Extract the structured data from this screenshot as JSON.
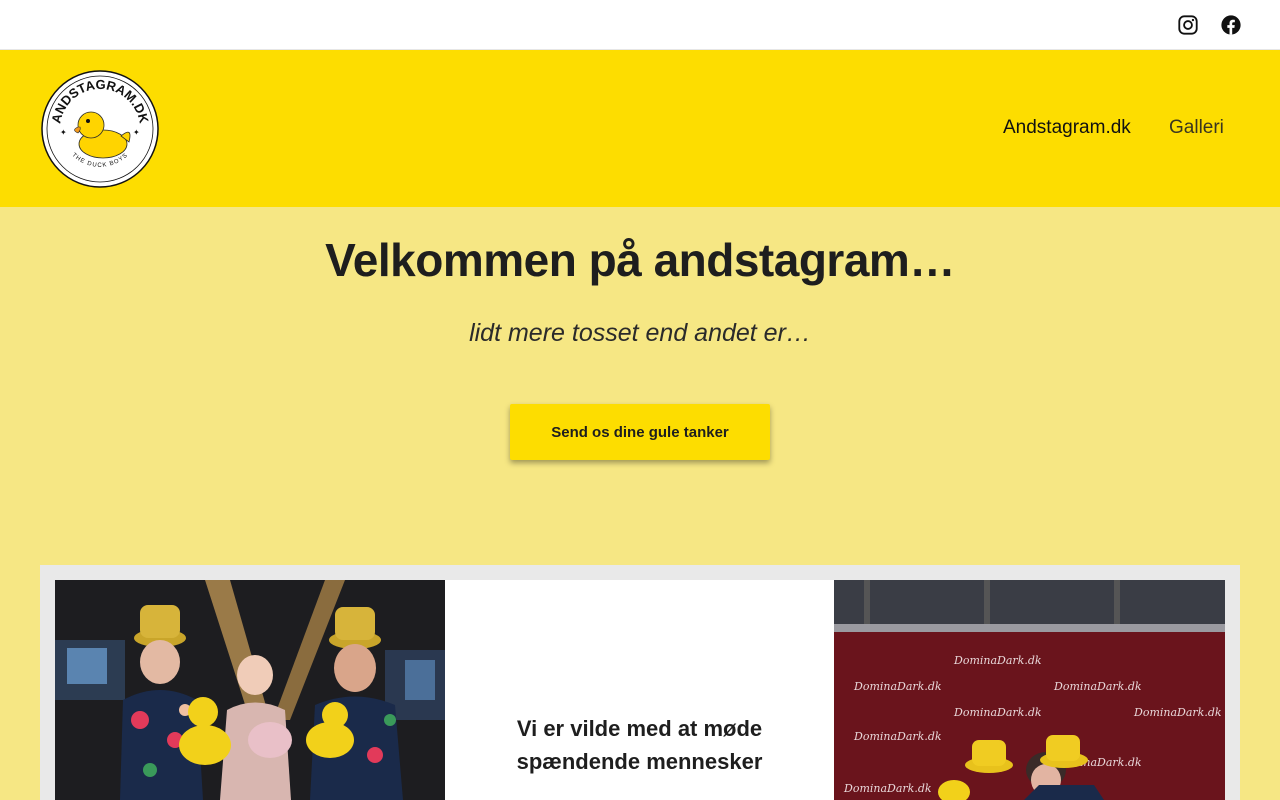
{
  "topbar": {
    "social": [
      {
        "icon": "instagram-icon"
      },
      {
        "icon": "facebook-icon"
      }
    ]
  },
  "header": {
    "logo": {
      "ring_text": "ANDSTAGRAM.DK",
      "bottom_text": "THE DUCK BOYS"
    },
    "nav": {
      "home": "Andstagram.dk",
      "gallery": "Galleri"
    }
  },
  "hero": {
    "title": "Velkommen på andstagram…",
    "subtitle": "lidt mere tosset end andet er…",
    "cta_label": "Send os dine gule tanker"
  },
  "gallery": {
    "center_text_line1": "Vi er vilde med at møde",
    "center_text_line2": "spændende mennesker",
    "banner_text": "DominaDark.dk"
  },
  "colors": {
    "header_yellow": "#fddd00",
    "page_yellow": "#f6e784",
    "text_dark": "#1e1e1e"
  }
}
